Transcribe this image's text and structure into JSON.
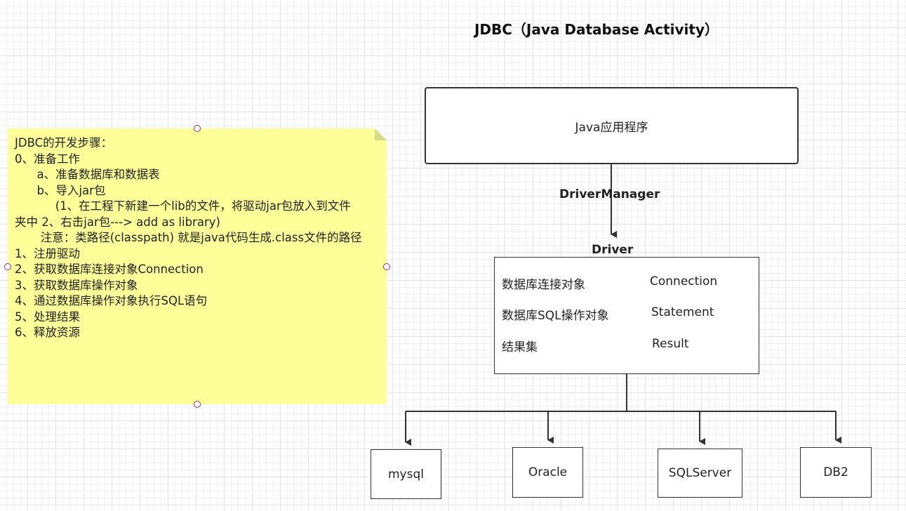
{
  "title": "JDBC（Java Database Activity）",
  "app_box": {
    "label": "Java应用程序"
  },
  "driver_manager_label": "DriverManager",
  "driver": {
    "label": "Driver",
    "rows": [
      {
        "name": "数据库连接对象",
        "value": "Connection"
      },
      {
        "name": "数据库SQL操作对象",
        "value": "Statement"
      },
      {
        "name": "结果集",
        "value": "Result"
      }
    ]
  },
  "databases": [
    "mysql",
    "Oracle",
    "SQLServer",
    "DB2"
  ],
  "note": {
    "lines": [
      "JDBC的开发步骤：",
      "0、准备工作",
      "      a、准备数据库和数据表",
      "      b、导入jar包",
      "           (1、在工程下新建一个lib的文件，将驱动jar包放入到文件",
      "夹中 2、右击jar包---> add as library)",
      "       注意：类路径(classpath) 就是java代码生成.class文件的路径",
      "1、注册驱动",
      "2、获取数据库连接对象Connection",
      "3、获取数据库操作对象",
      "4、通过数据库操作对象执行SQL语句",
      "5、处理结果",
      "6、释放资源"
    ]
  }
}
